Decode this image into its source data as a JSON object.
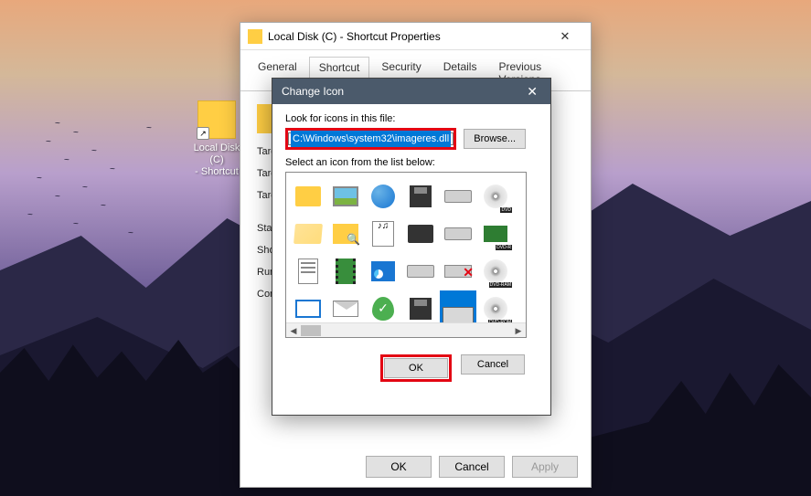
{
  "desktop": {
    "shortcut_label": "Local Disk (C)\n- Shortcut"
  },
  "properties": {
    "title": "Local Disk (C) - Shortcut Properties",
    "tabs": [
      "General",
      "Shortcut",
      "Security",
      "Details",
      "Previous Versions"
    ],
    "active_tab_index": 1,
    "fields": {
      "target_type_label": "Target type:",
      "target_location_label": "Target location:",
      "target_label": "Target:",
      "start_in_label": "Start in:",
      "shortcut_key_label": "Shortcut key:",
      "run_label": "Run:",
      "comment_label": "Comment:"
    },
    "buttons": {
      "ok": "OK",
      "cancel": "Cancel",
      "apply": "Apply"
    }
  },
  "change_icon": {
    "title": "Change Icon",
    "look_label": "Look for icons in this file:",
    "path_value": "C:\\Windows\\system32\\imageres.dll",
    "browse_label": "Browse...",
    "select_label": "Select an icon from the list below:",
    "dvd_labels": {
      "dvd": "DVD",
      "dvdr": "DVD-R",
      "dvdram": "DVD-RAM",
      "dvdrom": "DVD-ROM"
    },
    "buttons": {
      "ok": "OK",
      "cancel": "Cancel"
    }
  }
}
